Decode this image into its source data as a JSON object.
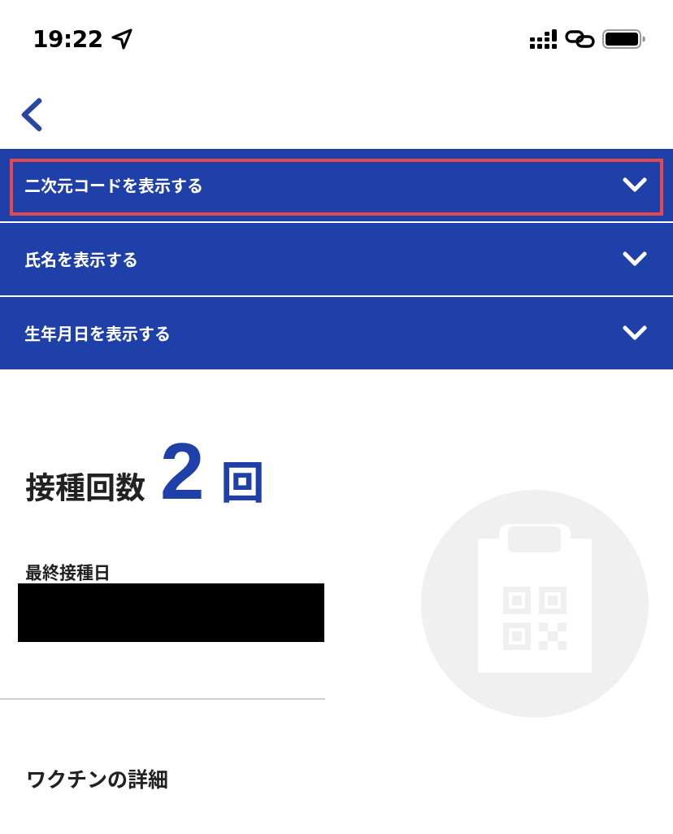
{
  "status_bar": {
    "time": "19:22"
  },
  "accordion": [
    {
      "label": "二次元コードを表示する",
      "expanded": false,
      "highlighted": true
    },
    {
      "label": "氏名を表示する",
      "expanded": false,
      "highlighted": false
    },
    {
      "label": "生年月日を表示する",
      "expanded": false,
      "highlighted": false
    }
  ],
  "summary": {
    "label": "接種回数",
    "count": "2",
    "unit": "回"
  },
  "last_date": {
    "label": "最終接種日"
  },
  "vaccine_details": {
    "title": "ワクチンの詳細"
  }
}
